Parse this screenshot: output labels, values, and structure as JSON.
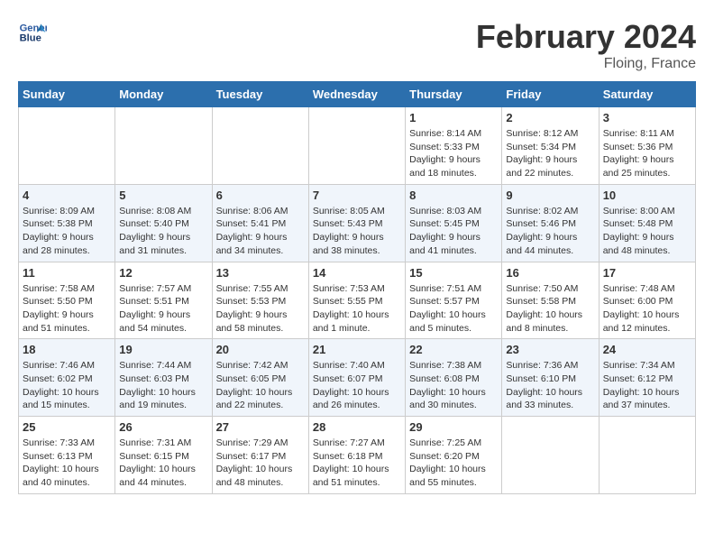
{
  "header": {
    "logo_line1": "General",
    "logo_line2": "Blue",
    "month_year": "February 2024",
    "location": "Floing, France"
  },
  "columns": [
    "Sunday",
    "Monday",
    "Tuesday",
    "Wednesday",
    "Thursday",
    "Friday",
    "Saturday"
  ],
  "weeks": [
    [
      {
        "day": "",
        "sunrise": "",
        "sunset": "",
        "daylight": ""
      },
      {
        "day": "",
        "sunrise": "",
        "sunset": "",
        "daylight": ""
      },
      {
        "day": "",
        "sunrise": "",
        "sunset": "",
        "daylight": ""
      },
      {
        "day": "",
        "sunrise": "",
        "sunset": "",
        "daylight": ""
      },
      {
        "day": "1",
        "sunrise": "Sunrise: 8:14 AM",
        "sunset": "Sunset: 5:33 PM",
        "daylight": "Daylight: 9 hours and 18 minutes."
      },
      {
        "day": "2",
        "sunrise": "Sunrise: 8:12 AM",
        "sunset": "Sunset: 5:34 PM",
        "daylight": "Daylight: 9 hours and 22 minutes."
      },
      {
        "day": "3",
        "sunrise": "Sunrise: 8:11 AM",
        "sunset": "Sunset: 5:36 PM",
        "daylight": "Daylight: 9 hours and 25 minutes."
      }
    ],
    [
      {
        "day": "4",
        "sunrise": "Sunrise: 8:09 AM",
        "sunset": "Sunset: 5:38 PM",
        "daylight": "Daylight: 9 hours and 28 minutes."
      },
      {
        "day": "5",
        "sunrise": "Sunrise: 8:08 AM",
        "sunset": "Sunset: 5:40 PM",
        "daylight": "Daylight: 9 hours and 31 minutes."
      },
      {
        "day": "6",
        "sunrise": "Sunrise: 8:06 AM",
        "sunset": "Sunset: 5:41 PM",
        "daylight": "Daylight: 9 hours and 34 minutes."
      },
      {
        "day": "7",
        "sunrise": "Sunrise: 8:05 AM",
        "sunset": "Sunset: 5:43 PM",
        "daylight": "Daylight: 9 hours and 38 minutes."
      },
      {
        "day": "8",
        "sunrise": "Sunrise: 8:03 AM",
        "sunset": "Sunset: 5:45 PM",
        "daylight": "Daylight: 9 hours and 41 minutes."
      },
      {
        "day": "9",
        "sunrise": "Sunrise: 8:02 AM",
        "sunset": "Sunset: 5:46 PM",
        "daylight": "Daylight: 9 hours and 44 minutes."
      },
      {
        "day": "10",
        "sunrise": "Sunrise: 8:00 AM",
        "sunset": "Sunset: 5:48 PM",
        "daylight": "Daylight: 9 hours and 48 minutes."
      }
    ],
    [
      {
        "day": "11",
        "sunrise": "Sunrise: 7:58 AM",
        "sunset": "Sunset: 5:50 PM",
        "daylight": "Daylight: 9 hours and 51 minutes."
      },
      {
        "day": "12",
        "sunrise": "Sunrise: 7:57 AM",
        "sunset": "Sunset: 5:51 PM",
        "daylight": "Daylight: 9 hours and 54 minutes."
      },
      {
        "day": "13",
        "sunrise": "Sunrise: 7:55 AM",
        "sunset": "Sunset: 5:53 PM",
        "daylight": "Daylight: 9 hours and 58 minutes."
      },
      {
        "day": "14",
        "sunrise": "Sunrise: 7:53 AM",
        "sunset": "Sunset: 5:55 PM",
        "daylight": "Daylight: 10 hours and 1 minute."
      },
      {
        "day": "15",
        "sunrise": "Sunrise: 7:51 AM",
        "sunset": "Sunset: 5:57 PM",
        "daylight": "Daylight: 10 hours and 5 minutes."
      },
      {
        "day": "16",
        "sunrise": "Sunrise: 7:50 AM",
        "sunset": "Sunset: 5:58 PM",
        "daylight": "Daylight: 10 hours and 8 minutes."
      },
      {
        "day": "17",
        "sunrise": "Sunrise: 7:48 AM",
        "sunset": "Sunset: 6:00 PM",
        "daylight": "Daylight: 10 hours and 12 minutes."
      }
    ],
    [
      {
        "day": "18",
        "sunrise": "Sunrise: 7:46 AM",
        "sunset": "Sunset: 6:02 PM",
        "daylight": "Daylight: 10 hours and 15 minutes."
      },
      {
        "day": "19",
        "sunrise": "Sunrise: 7:44 AM",
        "sunset": "Sunset: 6:03 PM",
        "daylight": "Daylight: 10 hours and 19 minutes."
      },
      {
        "day": "20",
        "sunrise": "Sunrise: 7:42 AM",
        "sunset": "Sunset: 6:05 PM",
        "daylight": "Daylight: 10 hours and 22 minutes."
      },
      {
        "day": "21",
        "sunrise": "Sunrise: 7:40 AM",
        "sunset": "Sunset: 6:07 PM",
        "daylight": "Daylight: 10 hours and 26 minutes."
      },
      {
        "day": "22",
        "sunrise": "Sunrise: 7:38 AM",
        "sunset": "Sunset: 6:08 PM",
        "daylight": "Daylight: 10 hours and 30 minutes."
      },
      {
        "day": "23",
        "sunrise": "Sunrise: 7:36 AM",
        "sunset": "Sunset: 6:10 PM",
        "daylight": "Daylight: 10 hours and 33 minutes."
      },
      {
        "day": "24",
        "sunrise": "Sunrise: 7:34 AM",
        "sunset": "Sunset: 6:12 PM",
        "daylight": "Daylight: 10 hours and 37 minutes."
      }
    ],
    [
      {
        "day": "25",
        "sunrise": "Sunrise: 7:33 AM",
        "sunset": "Sunset: 6:13 PM",
        "daylight": "Daylight: 10 hours and 40 minutes."
      },
      {
        "day": "26",
        "sunrise": "Sunrise: 7:31 AM",
        "sunset": "Sunset: 6:15 PM",
        "daylight": "Daylight: 10 hours and 44 minutes."
      },
      {
        "day": "27",
        "sunrise": "Sunrise: 7:29 AM",
        "sunset": "Sunset: 6:17 PM",
        "daylight": "Daylight: 10 hours and 48 minutes."
      },
      {
        "day": "28",
        "sunrise": "Sunrise: 7:27 AM",
        "sunset": "Sunset: 6:18 PM",
        "daylight": "Daylight: 10 hours and 51 minutes."
      },
      {
        "day": "29",
        "sunrise": "Sunrise: 7:25 AM",
        "sunset": "Sunset: 6:20 PM",
        "daylight": "Daylight: 10 hours and 55 minutes."
      },
      {
        "day": "",
        "sunrise": "",
        "sunset": "",
        "daylight": ""
      },
      {
        "day": "",
        "sunrise": "",
        "sunset": "",
        "daylight": ""
      }
    ]
  ]
}
